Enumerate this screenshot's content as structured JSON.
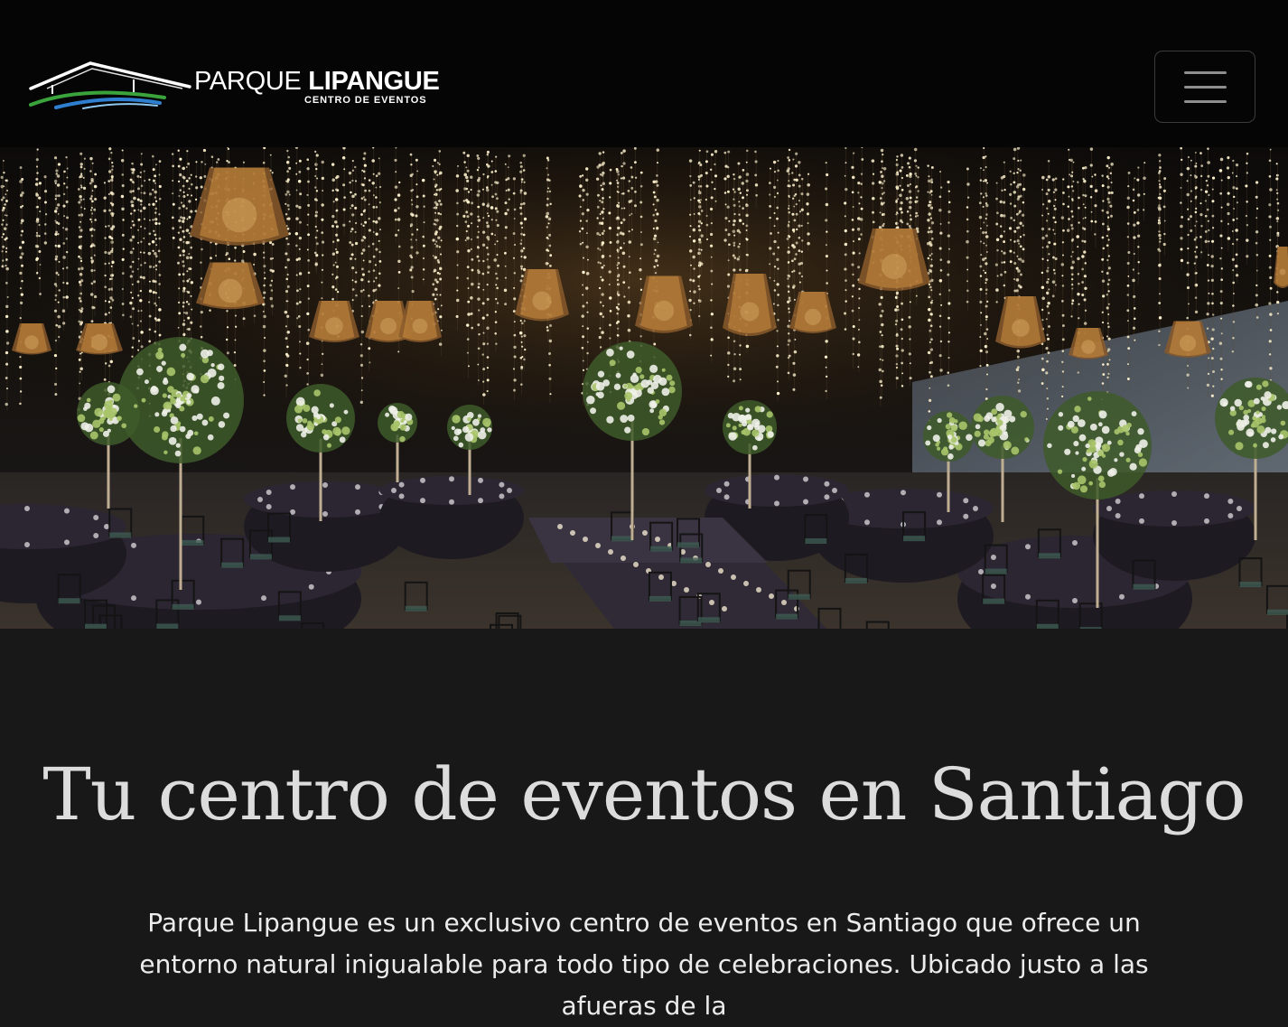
{
  "header": {
    "brand_light": "PARQUE ",
    "brand_bold": "LIPANGUE",
    "brand_sub": "CENTRO DE EVENTOS",
    "menu_icon": "hamburger-menu-icon"
  },
  "hero": {
    "image": "event-hall-photo"
  },
  "intro": {
    "title": "Tu centro de eventos en Santiago",
    "body": "Parque Lipangue es un exclusivo centro de eventos en Santiago que ofrece un entorno natural inigualable para todo tipo de celebraciones. Ubicado justo a las afueras de la"
  },
  "colors": {
    "header_bg": "#050505",
    "page_bg": "#181818",
    "logo_green": "#3aa33c",
    "logo_blue": "#2f7fd0"
  }
}
